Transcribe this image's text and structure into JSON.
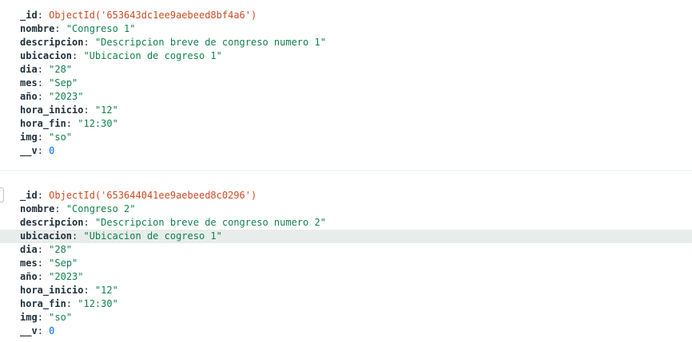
{
  "documents": [
    {
      "fields": [
        {
          "key": "_id",
          "value": "ObjectId('653643dc1ee9aebeed8bf4a6')",
          "type": "oid"
        },
        {
          "key": "nombre",
          "value": "\"Congreso 1\"",
          "type": "str"
        },
        {
          "key": "descripcion",
          "value": "\"Descripcion breve de congreso numero 1\"",
          "type": "str"
        },
        {
          "key": "ubicacion",
          "value": "\"Ubicacion de cogreso 1\"",
          "type": "str"
        },
        {
          "key": "dia",
          "value": "\"28\"",
          "type": "str"
        },
        {
          "key": "mes",
          "value": "\"Sep\"",
          "type": "str"
        },
        {
          "key": "año",
          "value": "\"2023\"",
          "type": "str"
        },
        {
          "key": "hora_inicio",
          "value": "\"12\"",
          "type": "str"
        },
        {
          "key": "hora_fin",
          "value": "\"12:30\"",
          "type": "str"
        },
        {
          "key": "img",
          "value": "\"so\"",
          "type": "str"
        },
        {
          "key": "__v",
          "value": "0",
          "type": "num"
        }
      ]
    },
    {
      "fields": [
        {
          "key": "_id",
          "value": "ObjectId('653644041ee9aebeed8c0296')",
          "type": "oid"
        },
        {
          "key": "nombre",
          "value": "\"Congreso 2\"",
          "type": "str"
        },
        {
          "key": "descripcion",
          "value": "\"Descripcion breve de congreso numero 2\"",
          "type": "str"
        },
        {
          "key": "ubicacion",
          "value": "\"Ubicacion de cogreso 1\"",
          "type": "str"
        },
        {
          "key": "dia",
          "value": "\"28\"",
          "type": "str"
        },
        {
          "key": "mes",
          "value": "\"Sep\"",
          "type": "str"
        },
        {
          "key": "año",
          "value": "\"2023\"",
          "type": "str"
        },
        {
          "key": "hora_inicio",
          "value": "\"12\"",
          "type": "str"
        },
        {
          "key": "hora_fin",
          "value": "\"12:30\"",
          "type": "str"
        },
        {
          "key": "img",
          "value": "\"so\"",
          "type": "str"
        },
        {
          "key": "__v",
          "value": "0",
          "type": "num"
        }
      ]
    }
  ],
  "colors": {
    "key": "#21313c",
    "string": "#12824d",
    "objectid": "#cf4a22",
    "number": "#016bf8",
    "highlight": "#e8edeb"
  }
}
